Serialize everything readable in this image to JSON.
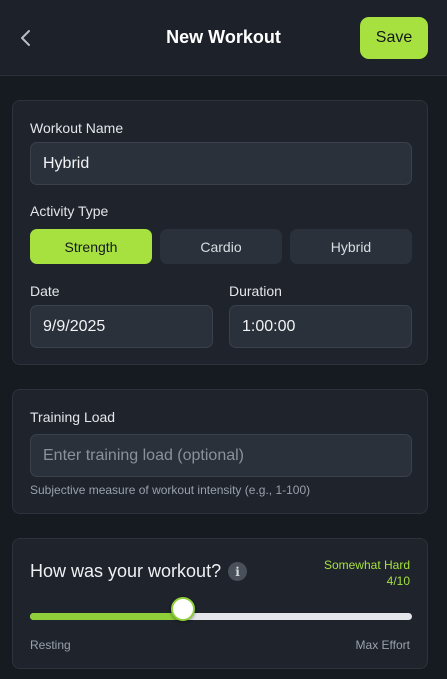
{
  "header": {
    "title": "New Workout",
    "save_label": "Save",
    "back_icon": "chevron-left-icon"
  },
  "workout_name": {
    "label": "Workout Name",
    "value": "Hybrid"
  },
  "activity_type": {
    "label": "Activity Type",
    "options": [
      "Strength",
      "Cardio",
      "Hybrid"
    ],
    "selected": "Strength"
  },
  "date": {
    "label": "Date",
    "value": "9/9/2025"
  },
  "duration": {
    "label": "Duration",
    "value": "1:00:00"
  },
  "training_load": {
    "label": "Training Load",
    "placeholder": "Enter training load (optional)",
    "value": "",
    "hint": "Subjective measure of workout intensity (e.g., 1-100)"
  },
  "feeling": {
    "question": "How was your workout?",
    "info_icon": "info-icon",
    "rating_text": "Somewhat Hard",
    "rating_score": "4/10",
    "slider_value": 4,
    "slider_min": 0,
    "slider_max": 10,
    "min_label": "Resting",
    "max_label": "Max Effort"
  },
  "colors": {
    "accent": "#a6e13f",
    "background": "#161a21",
    "card": "#1e232c",
    "field": "#2b313b"
  }
}
